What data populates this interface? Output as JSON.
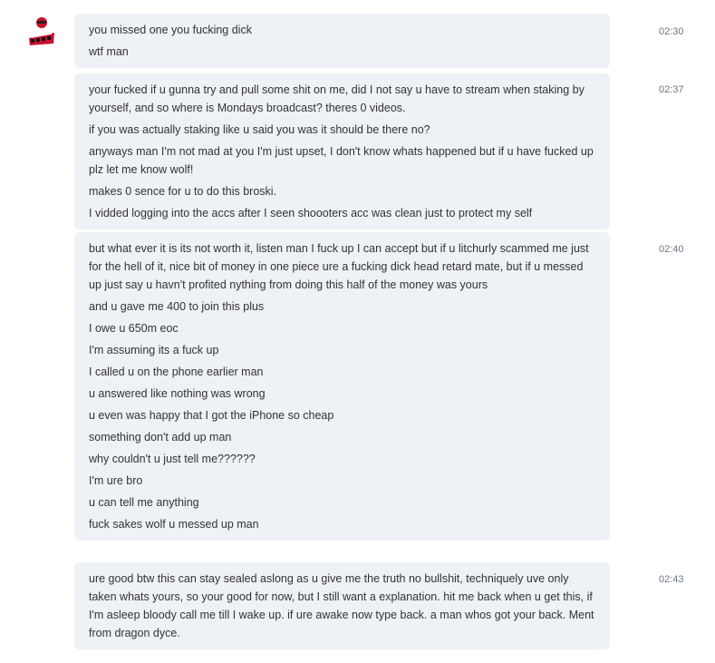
{
  "groups": [
    {
      "time": "02:30",
      "messages": [
        "you missed one you fucking dick",
        "wtf man"
      ]
    },
    {
      "time": "02:37",
      "messages": [
        "your fucked if u gunna try and pull some shit on me, did I not say u have to stream when staking by yourself, and so where is Mondays broadcast? theres 0 videos.",
        "if you was actually staking like u said you was it should be there no?",
        "anyways man I'm not mad at you I'm just upset, I don't know whats happened but if u have fucked up plz let me know wolf!",
        "makes 0 sence for u to do this broski.",
        "I vidded logging into the accs after I seen shoooters acc was clean just to protect my self"
      ]
    },
    {
      "time": "02:40",
      "messages": [
        "but what ever it is its not worth it, listen man I fuck up I can accept but if u litchurly scammed me just for the hell of it, nice bit of money in one piece ure a fucking dick head retard mate, but if u messed up just say u havn't profited nything from doing this half of the money was yours",
        "and u gave me 400 to join this plus",
        "I owe u 650m eoc",
        "I'm assuming its a fuck up",
        "I called u on the phone earlier man",
        "u answered like nothing was wrong",
        "u even was happy that I got the iPhone so cheap",
        "something don't add up man",
        "why couldn't u just tell me??????",
        "I'm ure bro",
        "u can tell me anything",
        "fuck sakes wolf u messed up man"
      ]
    },
    {
      "time": "02:43",
      "messages": [
        "ure good btw this can stay sealed aslong as u give me the truth no bullshit, techniquely uve only taken whats yours, so your good for now, but I still want a explanation. hit me back when u get this, if I'm asleep bloody call me till I wake up. if ure awake now type back. a man whos got your back. Ment from dragon dyce."
      ]
    }
  ]
}
